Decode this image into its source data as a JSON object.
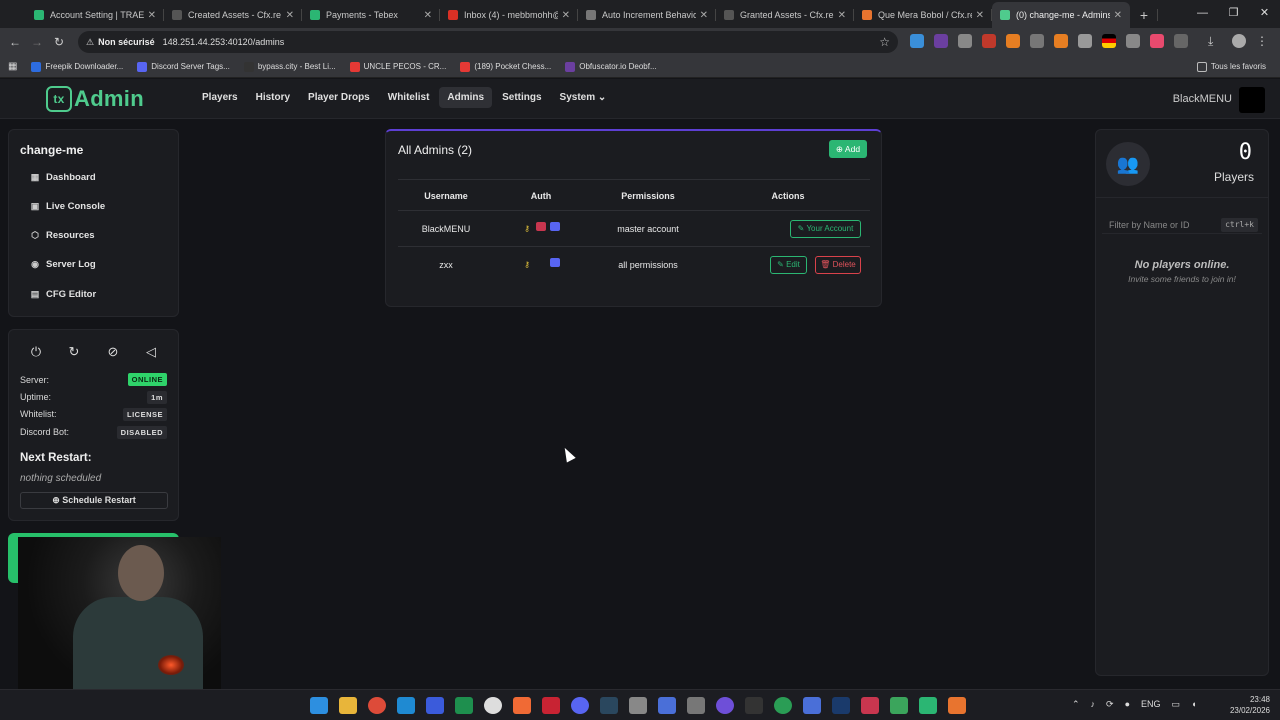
{
  "browser": {
    "tabs": [
      {
        "title": "Account Setting | TRAE - ",
        "color": "#2bb673",
        "active": false
      },
      {
        "title": "Created Assets - Cfx.re Pl",
        "color": "#444",
        "active": false
      },
      {
        "title": "Payments - Tebex",
        "color": "#2bb673",
        "active": false
      },
      {
        "title": "Inbox (4) - mebbmohh@g",
        "color": "#d93025",
        "active": false
      },
      {
        "title": "Auto Increment Behavior",
        "color": "#666",
        "active": false
      },
      {
        "title": "Granted Assets - Cfx.re Pl",
        "color": "#444",
        "active": false
      },
      {
        "title": "Que Mera Bobol / Cfx.re",
        "color": "#e8742f",
        "active": false
      },
      {
        "title": "(0) change-me - Admins",
        "color": "#4fcb8d",
        "active": true
      }
    ],
    "security_label": "Non sécurisé",
    "url": "148.251.44.253:40120/admins",
    "bookmarks": [
      {
        "label": "Freepik Downloader...",
        "color": "#2d6cdf"
      },
      {
        "label": "Discord Server Tags...",
        "color": "#5865f2"
      },
      {
        "label": "bypass.city - Best Li...",
        "color": "#333"
      },
      {
        "label": "UNCLE PECOS - CR...",
        "color": "#e53935"
      },
      {
        "label": "(189) Pocket Chess...",
        "color": "#e53935"
      },
      {
        "label": "Obfuscator.io Deobf...",
        "color": "#6b3fa0"
      }
    ],
    "all_bookmarks": "Tous les favoris"
  },
  "header": {
    "logo_prefix": "tx",
    "logo_text": "Admin",
    "menu": [
      "Players",
      "History",
      "Player Drops",
      "Whitelist",
      "Admins",
      "Settings",
      "System ⌄"
    ],
    "active_menu": "Admins",
    "username": "BlackMENU"
  },
  "sidebar": {
    "server_name": "change-me",
    "items": [
      {
        "label": "Dashboard",
        "icon": "grid-icon"
      },
      {
        "label": "Live Console",
        "icon": "terminal-icon"
      },
      {
        "label": "Resources",
        "icon": "box-icon"
      },
      {
        "label": "Server Log",
        "icon": "eye-icon"
      },
      {
        "label": "CFG Editor",
        "icon": "file-edit-icon"
      }
    ],
    "status": {
      "server_label": "Server:",
      "server_value": "ONLINE",
      "uptime_label": "Uptime:",
      "uptime_value": "1m",
      "whitelist_label": "Whitelist:",
      "whitelist_value": "LICENSE",
      "discord_label": "Discord Bot:",
      "discord_value": "DISABLED"
    },
    "next_restart_title": "Next Restart:",
    "next_restart_value": "nothing scheduled",
    "schedule_button": "⊕ Schedule Restart"
  },
  "admins": {
    "title": "All Admins (2)",
    "add_button": "⊕ Add",
    "columns": [
      "Username",
      "Auth",
      "Permissions",
      "Actions"
    ],
    "rows": [
      {
        "username": "BlackMENU",
        "permissions": "master account",
        "action_primary": "✎ Your Account"
      },
      {
        "username": "zxx",
        "permissions": "all permissions",
        "action_primary": "✎ Edit",
        "action_secondary": "🗑 Delete"
      }
    ]
  },
  "players": {
    "count": "0",
    "label": "Players",
    "filter_placeholder": "Filter by Name or ID",
    "shortcut": "ctrl+k",
    "empty_title": "No players online.",
    "empty_subtitle": "Invite some friends to join in!"
  },
  "taskbar": {
    "lang": "ENG",
    "time": "23:48",
    "date": "23/02/2026"
  }
}
